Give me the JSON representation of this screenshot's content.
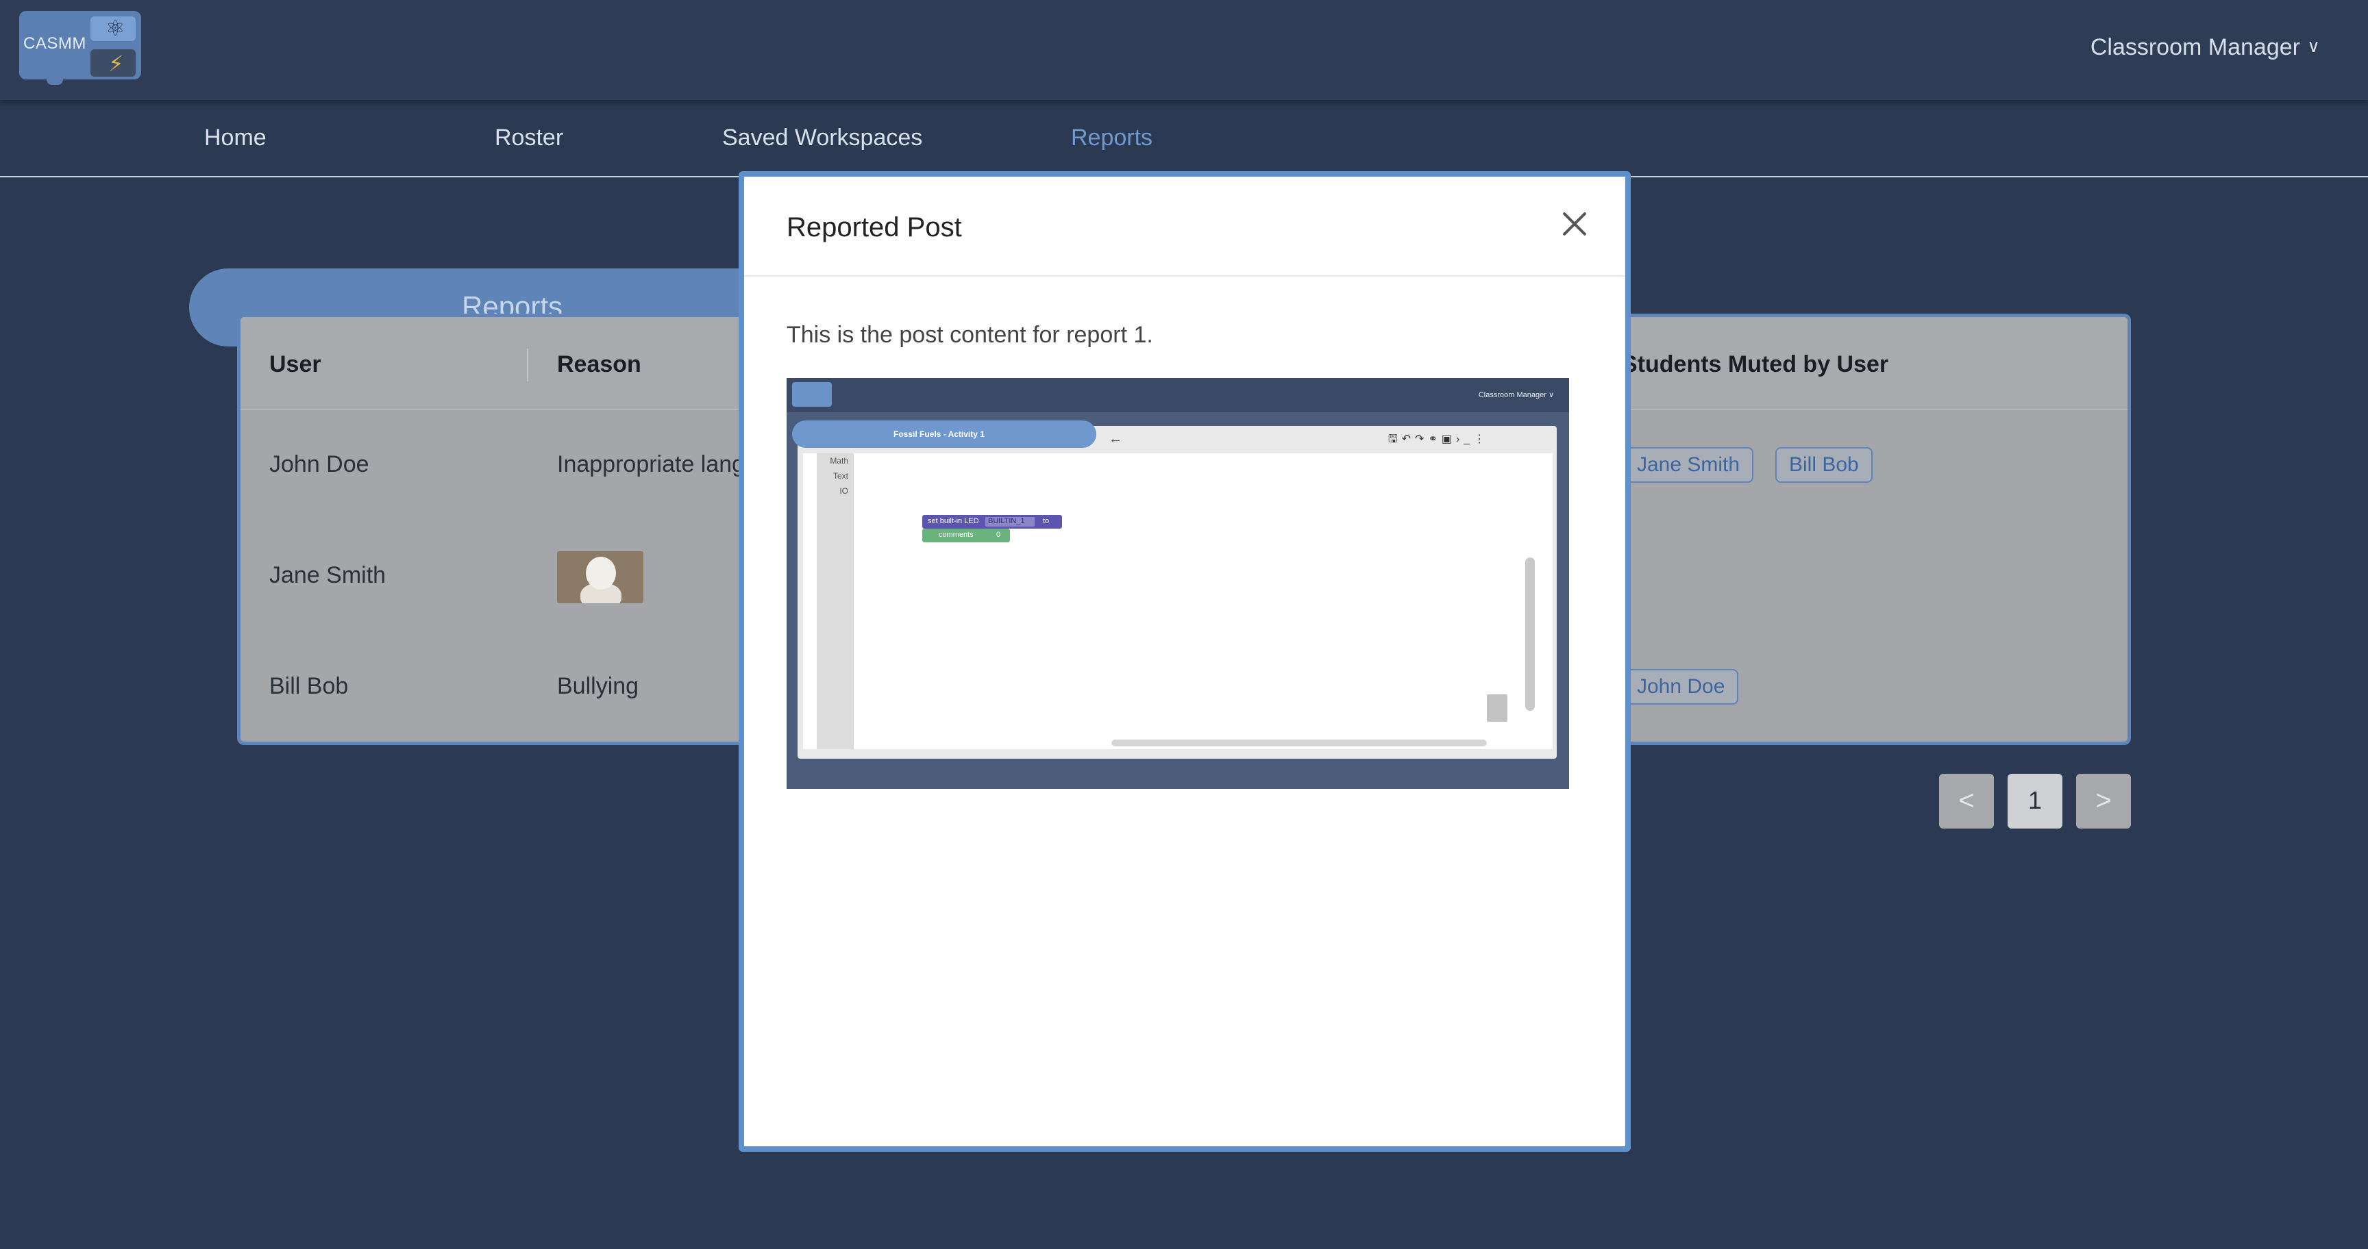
{
  "header": {
    "logo_text": "CASMM",
    "user_menu_label": "Classroom Manager",
    "user_menu_chevron": "chevron-down-icon"
  },
  "nav": {
    "items": [
      {
        "label": "Home",
        "active": false
      },
      {
        "label": "Roster",
        "active": false
      },
      {
        "label": "Saved Workspaces",
        "active": false
      },
      {
        "label": "Reports",
        "active": true
      }
    ]
  },
  "reports": {
    "title": "Reports",
    "columns": [
      "User",
      "Reason",
      "Students Muted by User"
    ],
    "rows": [
      {
        "user": "John Doe",
        "reason": "Inappropriate lang",
        "reason_type": "text",
        "muted": [
          "Jane Smith",
          "Bill Bob"
        ]
      },
      {
        "user": "Jane Smith",
        "reason": "",
        "reason_type": "image",
        "muted": []
      },
      {
        "user": "Bill Bob",
        "reason": "Bullying",
        "reason_type": "text",
        "muted": [
          "John Doe"
        ]
      }
    ]
  },
  "pagination": {
    "prev_label": "<",
    "current_page": "1",
    "next_label": ">"
  },
  "modal": {
    "title": "Reported Post",
    "content": "This is the post content for report 1.",
    "close_icon": "close-icon",
    "screenshot": {
      "user_menu_label": "Classroom Manager ∨",
      "tab_title": "Fossil Fuels - Activity 1",
      "categories": [
        "Math",
        "Text",
        "IO"
      ],
      "block_1": "set built-in LED",
      "block_1_value": "BUILTIN_1",
      "block_1_suffix": "to",
      "block_2": "comments",
      "block_2_value": "0"
    }
  },
  "colors": {
    "background": "#2b3a52",
    "accent": "#5e84b8",
    "active_nav": "#6f98cf",
    "modal_border": "#5e90cc"
  }
}
